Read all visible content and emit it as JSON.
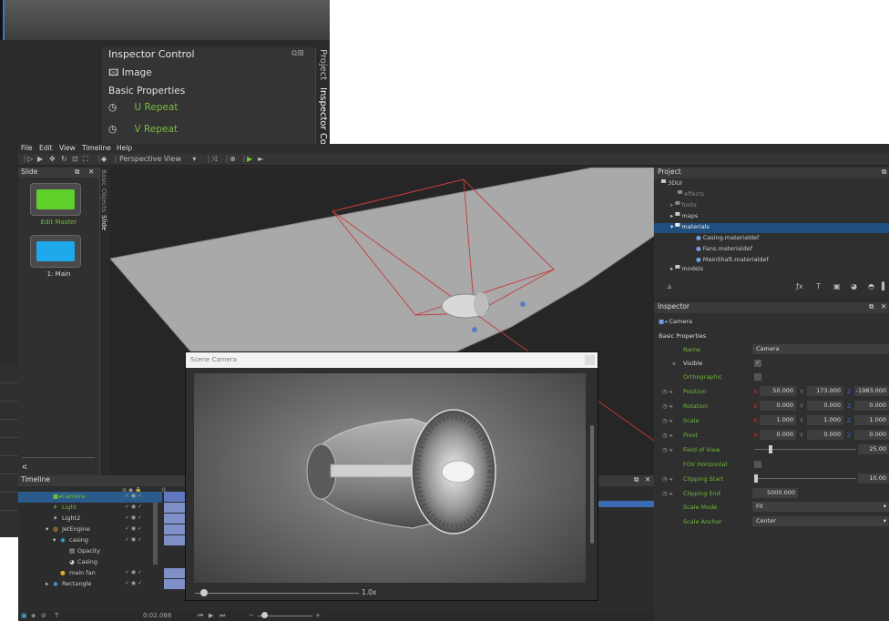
{
  "back_window": {
    "inspector_title": "Inspector Control",
    "item_label": "Image",
    "section_label": "Basic Properties",
    "u_repeat": "U Repeat",
    "v_repeat": "V Repeat",
    "tab_project": "Project",
    "tab_inspector": "Inspector Control"
  },
  "menu": [
    "File",
    "Edit",
    "View",
    "Timeline",
    "Help"
  ],
  "toolbar": {
    "view_mode": "Perspective View"
  },
  "slide_panel": {
    "title": "Slide",
    "tab_basic_objects": "Basic Objects",
    "tab_slide": "Slide",
    "slides": [
      {
        "label": "Edit Master",
        "color": "#5fcf2a"
      },
      {
        "label": "1: Main",
        "color": "#1ea9ec"
      }
    ]
  },
  "timeline": {
    "title": "Timeline",
    "rows": [
      {
        "label": "Camera",
        "selected": true,
        "has_bar": true
      },
      {
        "label": "Light",
        "selected": false,
        "has_bar": true
      },
      {
        "label": "Light2",
        "selected": false,
        "has_bar": true
      },
      {
        "label": "JetEngine",
        "selected": false,
        "has_bar": true
      },
      {
        "label": "casing",
        "selected": false,
        "has_bar": true
      },
      {
        "label": "Opacity",
        "selected": false,
        "has_bar": false
      },
      {
        "label": "Casing",
        "selected": false,
        "has_bar": false
      },
      {
        "label": "main fan",
        "selected": false,
        "has_bar": true
      },
      {
        "label": "Rectangle",
        "selected": false,
        "has_bar": true
      }
    ],
    "start_tick": "0",
    "current_time": "0:02.066"
  },
  "scene_camera": {
    "title": "Scene Camera",
    "zoom": "1.0x"
  },
  "project": {
    "title": "Project",
    "items": [
      {
        "label": "3DUI",
        "level": 0,
        "kind": "folder",
        "selected": false
      },
      {
        "label": "effects",
        "level": 1,
        "kind": "folder",
        "selected": false
      },
      {
        "label": "fonts",
        "level": 1,
        "kind": "folder",
        "selected": false
      },
      {
        "label": "maps",
        "level": 1,
        "kind": "folder",
        "selected": false
      },
      {
        "label": "materials",
        "level": 1,
        "kind": "folder",
        "selected": true
      },
      {
        "label": "Casing.materialdef",
        "level": 2,
        "kind": "file",
        "selected": false
      },
      {
        "label": "Fans.materialdef",
        "level": 2,
        "kind": "file",
        "selected": false
      },
      {
        "label": "MainShaft.materialdef",
        "level": 2,
        "kind": "file",
        "selected": false
      },
      {
        "label": "models",
        "level": 1,
        "kind": "folder",
        "selected": false
      }
    ]
  },
  "inspector": {
    "title": "Inspector",
    "object_label": "Camera",
    "section_label": "Basic Properties",
    "name_label": "Name",
    "name_value": "Camera",
    "visible_label": "Visible",
    "orthographic_label": "Orthographic",
    "position": {
      "label": "Position",
      "x": "50.000",
      "y": "173.000",
      "z": "-1983.000"
    },
    "rotation": {
      "label": "Rotation",
      "x": "0.000",
      "y": "0.000",
      "z": "0.000"
    },
    "scale": {
      "label": "Scale",
      "x": "1.000",
      "y": "1.000",
      "z": "1.000"
    },
    "pivot": {
      "label": "Pivot",
      "x": "0.000",
      "y": "0.000",
      "z": "0.000"
    },
    "fov_label": "Field of View",
    "fov_value": "25.00",
    "fov_horizontal_label": "FOV Horizontal",
    "clip_start_label": "Clipping Start",
    "clip_start_value": "10.00",
    "clip_end_label": "Clipping End",
    "clip_end_value": "5000.000",
    "scale_mode_label": "Scale Mode",
    "scale_mode_value": "Fit",
    "scale_anchor_label": "Scale Anchor",
    "scale_anchor_value": "Center",
    "axis_x": "X",
    "axis_y": "Y",
    "axis_z": "Z"
  },
  "colors": {
    "accent_green": "#6fb83a",
    "selection_blue": "#1f4f7e",
    "panel_bg": "#2f2f2f"
  }
}
